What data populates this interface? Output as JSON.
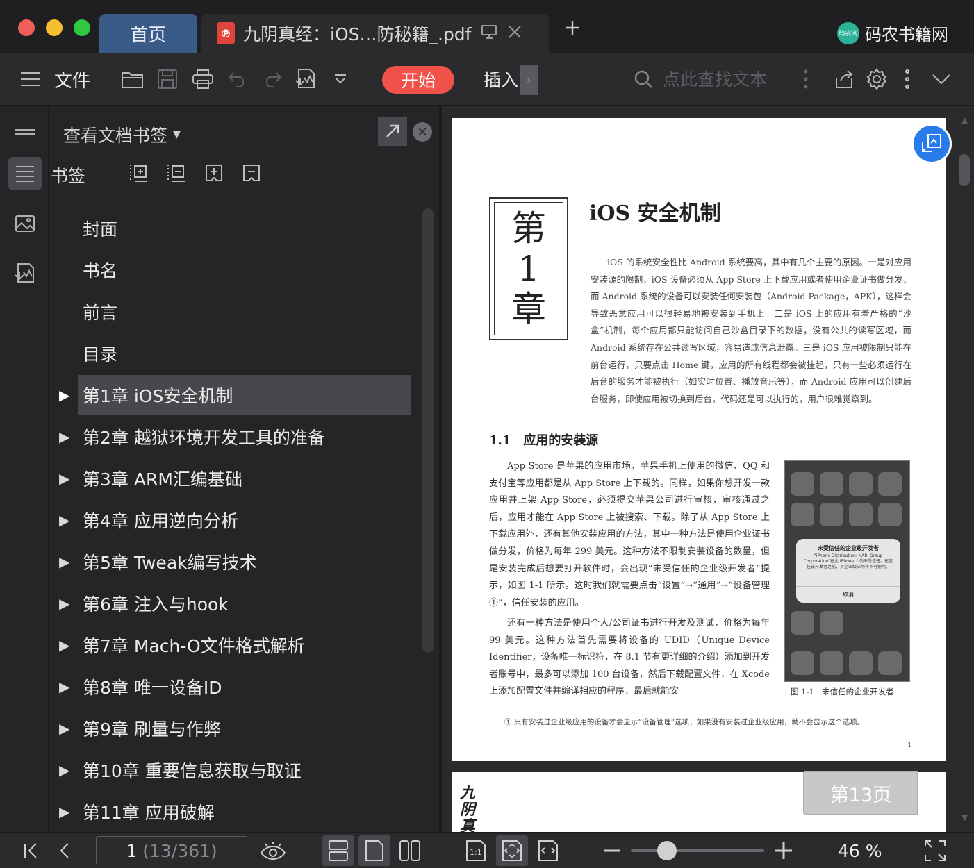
{
  "titlebar": {
    "tabs": [
      {
        "label": "首页"
      },
      {
        "label": "九阴真经：iOS…防秘籍_.pdf"
      }
    ],
    "brand": "码农书籍网",
    "brand_logo_text": "码农网"
  },
  "toolbar": {
    "file_label": "文件",
    "start_label": "开始",
    "insert_label": "插入",
    "insert_more": "›",
    "search_placeholder": "点此查找文本"
  },
  "panel": {
    "header": "查看文档书签",
    "bookmarks_title": "书签",
    "selected_index": 4,
    "items": [
      {
        "label": "封面",
        "expandable": false
      },
      {
        "label": "书名",
        "expandable": false
      },
      {
        "label": "前言",
        "expandable": false
      },
      {
        "label": "目录",
        "expandable": false
      },
      {
        "label": "第1章 iOS安全机制",
        "expandable": true
      },
      {
        "label": "第2章 越狱环境开发工具的准备",
        "expandable": true
      },
      {
        "label": "第3章 ARM汇编基础",
        "expandable": true
      },
      {
        "label": "第4章 应用逆向分析",
        "expandable": true
      },
      {
        "label": "第5章 Tweak编写技术",
        "expandable": true
      },
      {
        "label": "第6章 注入与hook",
        "expandable": true
      },
      {
        "label": "第7章 Mach-O文件格式解析",
        "expandable": true
      },
      {
        "label": "第8章 唯一设备ID",
        "expandable": true
      },
      {
        "label": "第9章 刷量与作弊",
        "expandable": true
      },
      {
        "label": "第10章 重要信息获取与取证",
        "expandable": true
      },
      {
        "label": "第11章 应用破解",
        "expandable": true
      }
    ]
  },
  "page": {
    "chapter_glyphs": [
      "第",
      "1",
      "章"
    ],
    "chapter_title": "iOS 安全机制",
    "intro": "iOS 的系统安全性比 Android 系统要高，其中有几个主要的原因。一是对应用安装源的限制，iOS 设备必须从 App Store 上下载应用或者使用企业证书做分发，而 Android 系统的设备可以安装任何安装包（Android Package，APK），这样会导致恶意应用可以很轻易地被安装到手机上。二是 iOS 上的应用有着严格的“沙盒”机制，每个应用都只能访问自己沙盒目录下的数据，没有公共的读写区域，而 Android 系统存在公共读写区域，容易造成信息泄露。三是 iOS 应用被限制只能在前台运行，只要点击 Home 键，应用的所有线程都会被挂起，只有一些必须运行在后台的服务才能被执行（如实时位置、播放音乐等），而 Android 应用可以创建后台服务，即使应用被切换到后台，代码还是可以执行的，用户很难觉察到。",
    "section_title": "1.1　应用的安装源",
    "para1": "App Store 是苹果的应用市场，苹果手机上使用的微信、QQ 和支付宝等应用都是从 App Store 上下载的。同样，如果你想开发一款应用并上架 App Store，必须提交苹果公司进行审核，审核通过之后，应用才能在 App Store 上被搜索、下载。除了从 App Store 上下载应用外，还有其他安装应用的方法，其中一种方法是使用企业证书做分发，价格为每年 299 美元。这种方法不限制安装设备的数量，但是安装完成后想要打开软件时，会出现“未受信任的企业级开发者”提示，如图 1-1 所示。这时我们就需要点击“设置”→“通用”→“设备管理①”，信任安装的应用。",
    "para2": "还有一种方法是使用个人/公司证书进行开发及测试，价格为每年 99 美元。这种方法首先需要将设备的 UDID（Unique Device Identifier，设备唯一标识符，在 8.1 节有更详细的介绍）添加到开发者账号中，最多可以添加 100 台设备，然后下载配置文件，在 Xcode 上添加配置文件并编译相应的程序，最后就能安",
    "alert_title": "未受信任的企业级开发者",
    "alert_body": "“iPhone Distribution: NARI Group Corporation”在此 iPhone 上尚未受信任。在信任该开发者之前，其企业级应用将不可使用。",
    "alert_cancel": "取消",
    "figure_caption": "图 1-1　未信任的企业开发者",
    "footnote": "① 只有安装过企业级应用的设备才会显示“设备管理”选项，如果没有安装过企业级应用，就不会显示这个选项。",
    "page_number": "1",
    "page_chip": "第13页"
  },
  "status": {
    "page_current": "1",
    "page_total": "(13/361)",
    "zoom": "46 %",
    "zoom_fraction": 0.27
  },
  "colors": {
    "accent_red": "#f0524a",
    "home_tab": "#3a5b87",
    "fab_blue": "#2a7bea"
  },
  "icons": [
    "menu-icon",
    "folder-open-icon",
    "save-icon",
    "print-icon",
    "undo-icon",
    "redo-icon",
    "export-icon",
    "chevron-down-icon",
    "search-icon",
    "share-icon",
    "gear-icon",
    "more-icon"
  ]
}
